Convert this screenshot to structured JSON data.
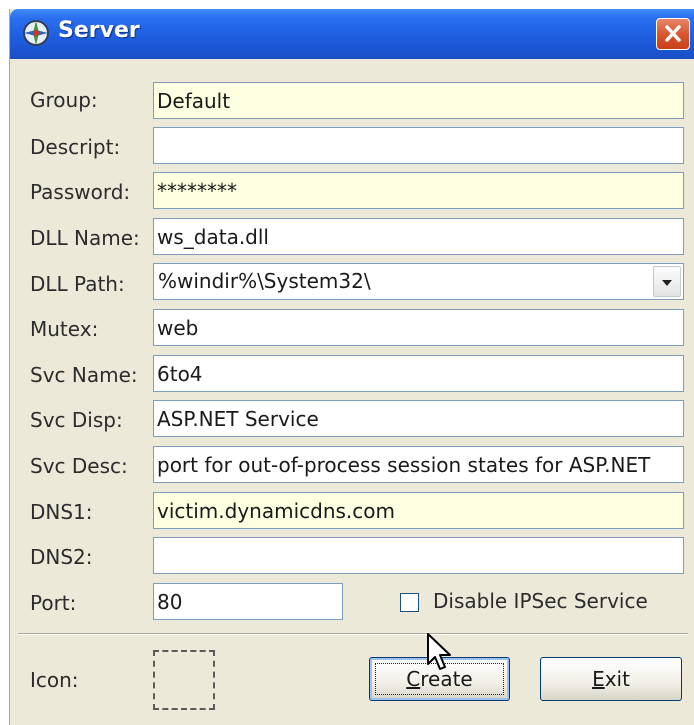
{
  "window": {
    "title": "Server"
  },
  "form": {
    "group": {
      "label": "Group:",
      "value": "Default"
    },
    "descript": {
      "label": "Descript:",
      "value": ""
    },
    "password": {
      "label": "Password:",
      "value": "********"
    },
    "dll_name": {
      "label": "DLL Name:",
      "value": "ws_data.dll"
    },
    "dll_path": {
      "label": "DLL Path:",
      "value": "%windir%\\System32\\"
    },
    "mutex": {
      "label": "Mutex:",
      "value": "web"
    },
    "svc_name": {
      "label": "Svc Name:",
      "value": "6to4"
    },
    "svc_disp": {
      "label": "Svc Disp:",
      "value": "ASP.NET Service"
    },
    "svc_desc": {
      "label": "Svc Desc:",
      "value": "port for out-of-process session states for ASP.NET"
    },
    "dns1": {
      "label": "DNS1:",
      "value": "victim.dynamicdns.com"
    },
    "dns2": {
      "label": "DNS2:",
      "value": ""
    },
    "port": {
      "label": "Port:",
      "value": "80"
    },
    "disable_ipsec": {
      "label": "Disable IPSec Service",
      "checked": false
    }
  },
  "footer": {
    "icon_label": "Icon:",
    "create_button": {
      "label": "Create",
      "mnemonic": "C",
      "rest": "reate"
    },
    "exit_button": {
      "label": "Exit",
      "mnemonic": "E",
      "rest": "xit"
    }
  },
  "colors": {
    "titlebar": "#1f5ee0",
    "window_bg": "#ece9d8",
    "highlight_field": "#ffffe1",
    "close_button": "#d9572f"
  },
  "icons": [
    "app-globe-icon",
    "close-icon",
    "chevron-down-icon",
    "mouse-cursor-icon"
  ]
}
